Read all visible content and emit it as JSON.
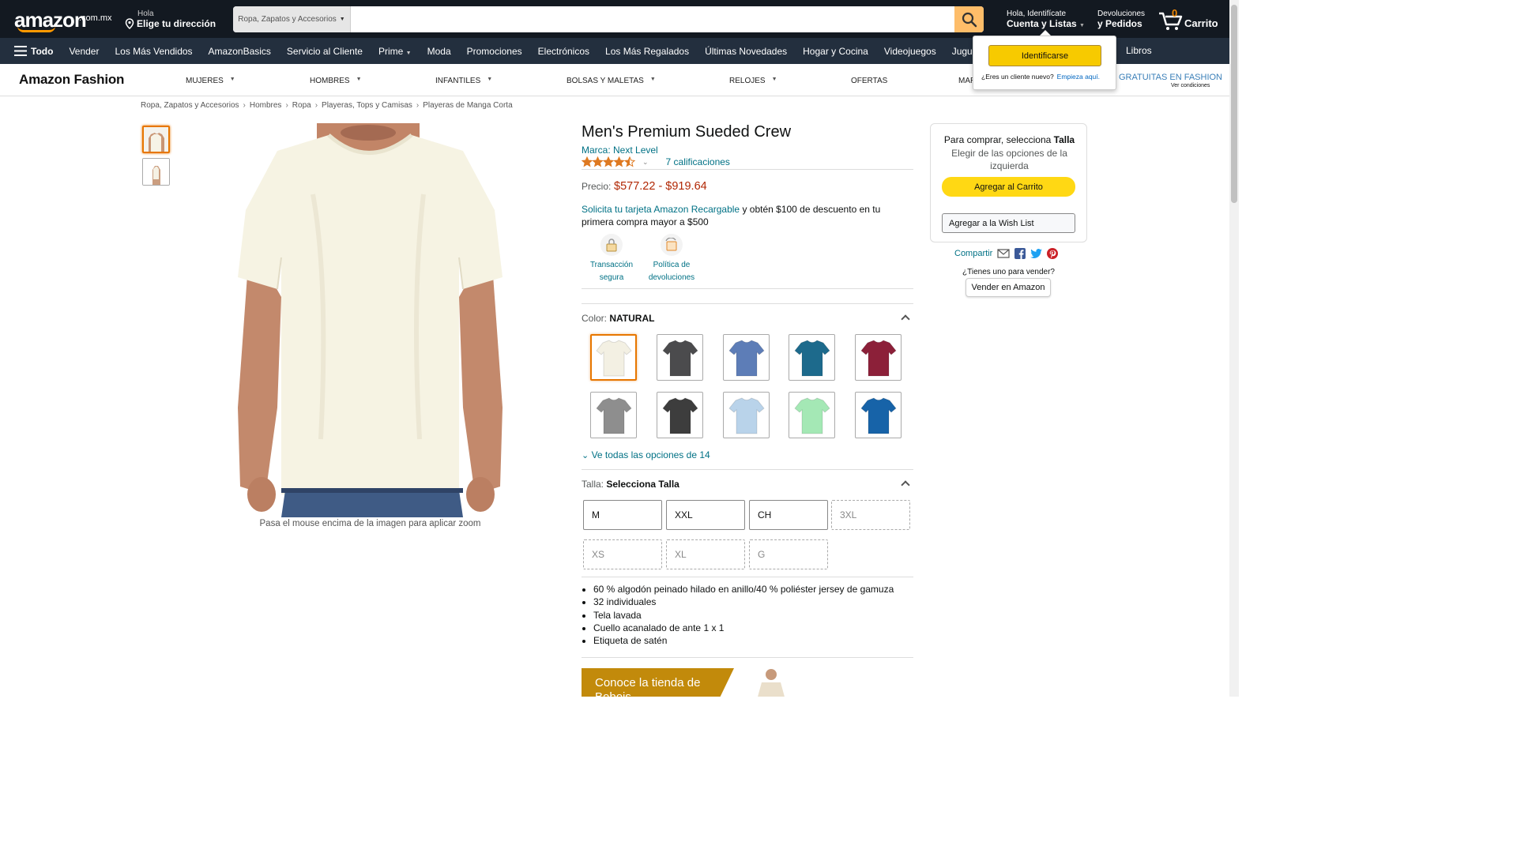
{
  "header": {
    "logo_text": "amazon",
    "logo_suffix": ".com.mx",
    "address_greeting": "Hola",
    "address_cta": "Elige tu dirección",
    "search_category": "Ropa, Zapatos y Accesorios",
    "search_placeholder": "",
    "account_greeting": "Hola, Identifícate",
    "account_label": "Cuenta y Listas",
    "returns_l1": "Devoluciones",
    "returns_l2": "y Pedidos",
    "cart_count": "0",
    "cart_label": "Carrito",
    "accent_color": "#febd69"
  },
  "nav": {
    "all_label": "Todo",
    "items": [
      "Vender",
      "Los Más Vendidos",
      "AmazonBasics",
      "Servicio al Cliente",
      "Prime",
      "Moda",
      "Promociones",
      "Electrónicos",
      "Los Más Regalados",
      "Últimas Novedades",
      "Hogar y Cocina",
      "Videojuegos",
      "Juguetes y jue"
    ],
    "right_item": "Libros"
  },
  "fashion_nav": {
    "logo": "Amazon Fashion",
    "items": [
      "MUJERES",
      "HOMBRES",
      "INFANTILES",
      "BOLSAS Y MALETAS",
      "RELOJES",
      "OFERTAS",
      "MAR"
    ],
    "promo": "GRATUITAS EN FASHION",
    "promo_sub": "Ver condiciones"
  },
  "flyout": {
    "signin": "Identificarse",
    "new_customer": "¿Eres un cliente nuevo?",
    "start_here": "Empieza aquí."
  },
  "breadcrumb": [
    "Ropa, Zapatos y Accesorios",
    "Hombres",
    "Ropa",
    "Playeras, Tops y Camisas",
    "Playeras de Manga Corta"
  ],
  "product": {
    "title": "Men's Premium Sueded Crew",
    "brand": "Marca: Next Level",
    "rating_stars": 4.5,
    "rating_count": "7 calificaciones",
    "price_label": "Precio:",
    "price": "$577.22 - $919.64",
    "promo_link": "Solicita tu tarjeta Amazon Recargable",
    "promo_text": "y obtén $100 de descuento en tu primera compra mayor a $500",
    "trust_1": "Transacción segura",
    "trust_2": "Política de devoluciones",
    "zoom_hint": "Pasa el mouse encima de la imagen para aplicar zoom",
    "color_label": "Color:",
    "color_value": "NATURAL",
    "color_swatches": [
      "#f3f0e3",
      "#4b4b4d",
      "#5d7db7",
      "#1d6a8c",
      "#8c2039",
      "#8e8e8e",
      "#3d3d3d",
      "#b9d3ea",
      "#a4e8b5",
      "#1763a8"
    ],
    "all_options": "Ve todas las opciones de 14",
    "size_label": "Talla:",
    "size_value": "Selecciona Talla",
    "sizes": [
      {
        "label": "M",
        "available": true
      },
      {
        "label": "XXL",
        "available": true
      },
      {
        "label": "CH",
        "available": true
      },
      {
        "label": "3XL",
        "available": false
      },
      {
        "label": "XS",
        "available": false
      },
      {
        "label": "XL",
        "available": false
      },
      {
        "label": "G",
        "available": false
      }
    ],
    "bullets": [
      "60 % algodón peinado hilado en anillo/40 % poliéster jersey de gamuza",
      "32 individuales",
      "Tela lavada",
      "Cuello acanalado de ante 1 x 1",
      "Etiqueta de satén"
    ],
    "store_banner": "Conoce la tienda de Bobois"
  },
  "buybox": {
    "line1_prefix": "Para comprar, selecciona",
    "line1_bold": "Talla",
    "line2": "Elegir de las opciones de la izquierda",
    "add_to_cart": "Agregar al Carrito",
    "add_to_wishlist": "Agregar a la Wish List",
    "share": "Compartir",
    "sell_question": "¿Tienes uno para vender?",
    "sell_button": "Vender en Amazon"
  }
}
